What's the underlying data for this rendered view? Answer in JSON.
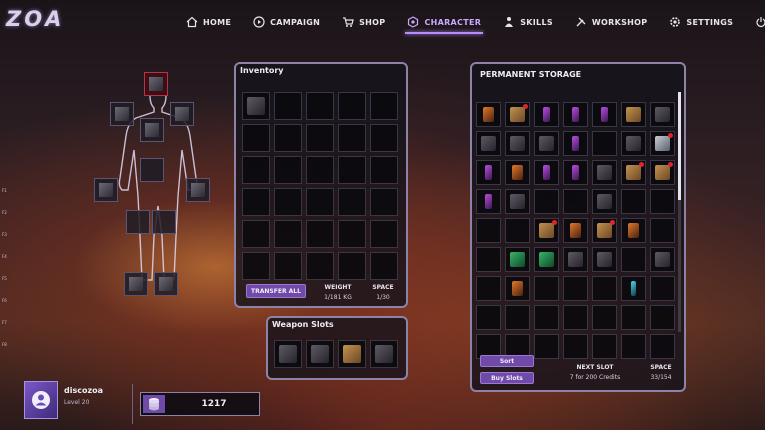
{
  "logo": "ZOA",
  "nav": [
    {
      "label": "HOME",
      "icon": "home-icon"
    },
    {
      "label": "CAMPAIGN",
      "icon": "play-circle-icon"
    },
    {
      "label": "SHOP",
      "icon": "cart-icon"
    },
    {
      "label": "CHARACTER",
      "icon": "hexagon-icon",
      "active": true
    },
    {
      "label": "SKILLS",
      "icon": "skills-icon"
    },
    {
      "label": "WORKSHOP",
      "icon": "tools-icon"
    },
    {
      "label": "SETTINGS",
      "icon": "gear-icon"
    },
    {
      "label": "EXIT",
      "icon": "power-icon"
    }
  ],
  "left_rail": [
    "F1",
    "F2",
    "F3",
    "F4",
    "F5",
    "F6",
    "F7",
    "F8"
  ],
  "inventory": {
    "title": "Inventory",
    "transfer_all": "TRANSFER ALL",
    "weight_label": "WEIGHT",
    "weight_value": "1/181 KG",
    "space_label": "SPACE",
    "space_value": "1/30",
    "items": [
      "dark",
      "",
      "",
      "",
      "",
      "",
      "",
      "",
      "",
      "",
      "",
      "",
      "",
      "",
      "",
      "",
      "",
      "",
      "",
      "",
      "",
      "",
      "",
      "",
      "",
      "",
      "",
      "",
      "",
      ""
    ]
  },
  "weapon_slots": {
    "title": "Weapon Slots",
    "items": [
      "dark",
      "dark",
      "tan",
      "dark"
    ]
  },
  "storage": {
    "title": "PERMANENT STORAGE",
    "sort": "Sort",
    "buy_slots": "Buy Slots",
    "next_slot_label": "NEXT SLOT",
    "next_slot_value": "7 for 200 Credits",
    "space_label": "SPACE",
    "space_value": "33/154",
    "items": [
      {
        "c": "orange"
      },
      {
        "c": "tan",
        "new": true
      },
      {
        "c": "purple"
      },
      {
        "c": "purple"
      },
      {
        "c": "purple"
      },
      {
        "c": "tan"
      },
      {
        "c": "dark"
      },
      {
        "c": "dark"
      },
      {
        "c": "dark"
      },
      {
        "c": "dark"
      },
      {
        "c": "purple"
      },
      {
        "c": ""
      },
      {
        "c": "dark"
      },
      {
        "c": "silver",
        "new": true
      },
      {
        "c": "purple"
      },
      {
        "c": "orange"
      },
      {
        "c": "purple"
      },
      {
        "c": "purple"
      },
      {
        "c": "dark"
      },
      {
        "c": "tan",
        "new": true
      },
      {
        "c": "tan",
        "new": true
      },
      {
        "c": "purple"
      },
      {
        "c": "dark"
      },
      {
        "c": ""
      },
      {
        "c": ""
      },
      {
        "c": "dark"
      },
      {
        "c": ""
      },
      {
        "c": ""
      },
      {
        "c": ""
      },
      {
        "c": ""
      },
      {
        "c": "tan",
        "new": true
      },
      {
        "c": "orange"
      },
      {
        "c": "tan",
        "new": true
      },
      {
        "c": "orange"
      },
      {
        "c": ""
      },
      {
        "c": ""
      },
      {
        "c": "green"
      },
      {
        "c": "green"
      },
      {
        "c": "dark"
      },
      {
        "c": "dark"
      },
      {
        "c": ""
      },
      {
        "c": "dark"
      },
      {
        "c": ""
      },
      {
        "c": "orange"
      },
      {
        "c": ""
      },
      {
        "c": ""
      },
      {
        "c": ""
      },
      {
        "c": "cyan"
      },
      {
        "c": ""
      },
      {
        "c": ""
      },
      {
        "c": ""
      },
      {
        "c": ""
      },
      {
        "c": ""
      },
      {
        "c": ""
      },
      {
        "c": ""
      },
      {
        "c": ""
      },
      {
        "c": ""
      },
      {
        "c": ""
      },
      {
        "c": ""
      },
      {
        "c": ""
      },
      {
        "c": ""
      },
      {
        "c": ""
      },
      {
        "c": ""
      }
    ]
  },
  "profile": {
    "username": "discozoa",
    "level": "Level 20"
  },
  "credits": "1217"
}
